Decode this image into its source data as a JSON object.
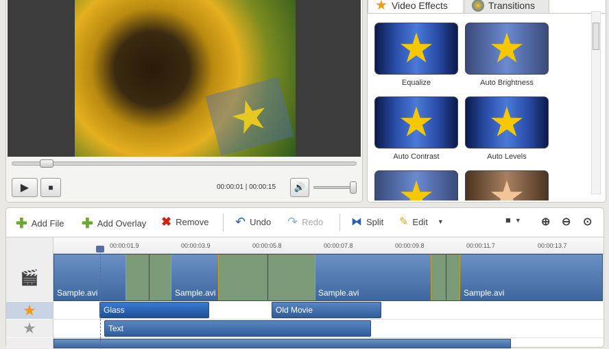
{
  "player": {
    "time": "00:00:01 | 00:00:15",
    "seek_progress": 0.1,
    "volume": 0.95
  },
  "effects": {
    "tabs": [
      {
        "label": "Video Effects"
      },
      {
        "label": "Transitions"
      }
    ],
    "items": [
      {
        "label": "Equalize"
      },
      {
        "label": "Auto Brightness"
      },
      {
        "label": "Auto Contrast"
      },
      {
        "label": "Auto Levels"
      },
      {
        "label": ""
      },
      {
        "label": ""
      }
    ]
  },
  "toolbar": {
    "add_file": "Add File",
    "add_overlay": "Add Overlay",
    "remove": "Remove",
    "undo": "Undo",
    "redo": "Redo",
    "split": "Split",
    "edit": "Edit"
  },
  "ruler": [
    "00:00:01.9",
    "00:00:03.9",
    "00:00:05.8",
    "00:00:07.8",
    "00:00:09.8",
    "00:00:11.7",
    "00:00:13.7"
  ],
  "video_clips": [
    {
      "label": "Sample.avi"
    },
    {
      "label": "Sample.avi"
    },
    {
      "label": "Sample.avi"
    },
    {
      "label": "Sample.avi"
    }
  ],
  "overlay_clips": [
    {
      "label": "Glass"
    },
    {
      "label": "Old Movie"
    }
  ],
  "text_clips": [
    {
      "label": "Text"
    }
  ]
}
